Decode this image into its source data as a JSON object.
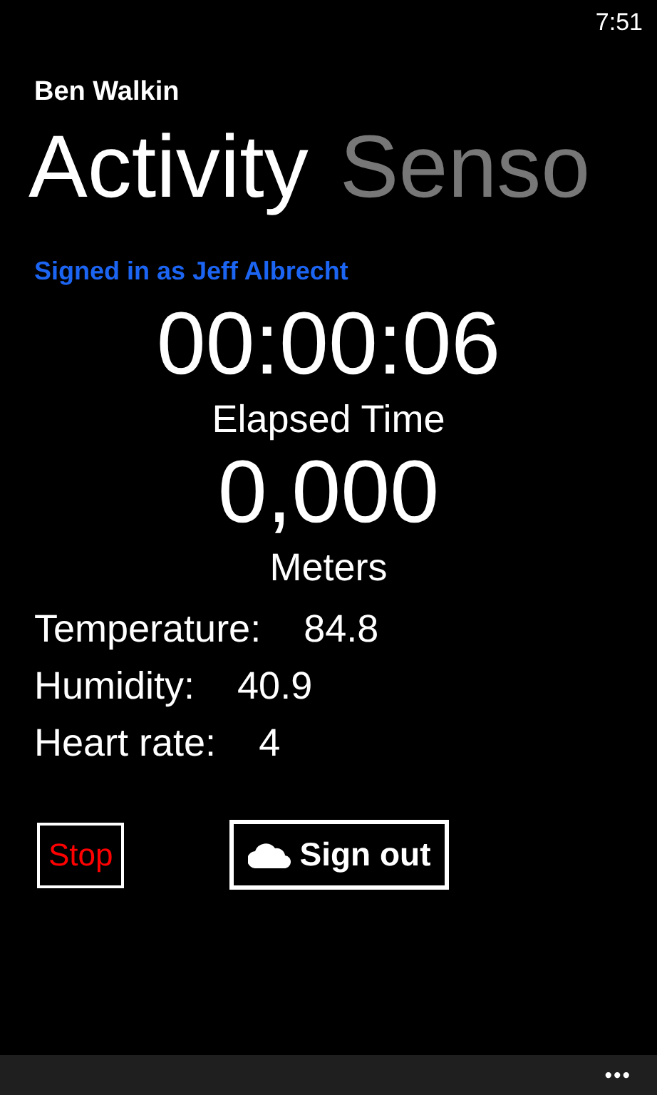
{
  "status_bar": {
    "time": "7:51"
  },
  "app_title": "Ben Walkin",
  "pivot": [
    {
      "label": "Activity",
      "selected": true
    },
    {
      "label": "Senso",
      "selected": false
    }
  ],
  "signed_in": "Signed in as Jeff Albrecht",
  "elapsed": {
    "value": "00:00:06",
    "label": "Elapsed Time"
  },
  "distance": {
    "value": "0,000",
    "label": "Meters"
  },
  "readings": [
    {
      "label": "Temperature:",
      "value": "84.8"
    },
    {
      "label": "Humidity:",
      "value": "40.9"
    },
    {
      "label": "Heart rate:",
      "value": "4"
    }
  ],
  "buttons": [
    {
      "kind": "stop",
      "label": "Stop"
    },
    {
      "kind": "signout",
      "label": "Sign out"
    }
  ],
  "app_bar": {
    "more": "•••"
  }
}
